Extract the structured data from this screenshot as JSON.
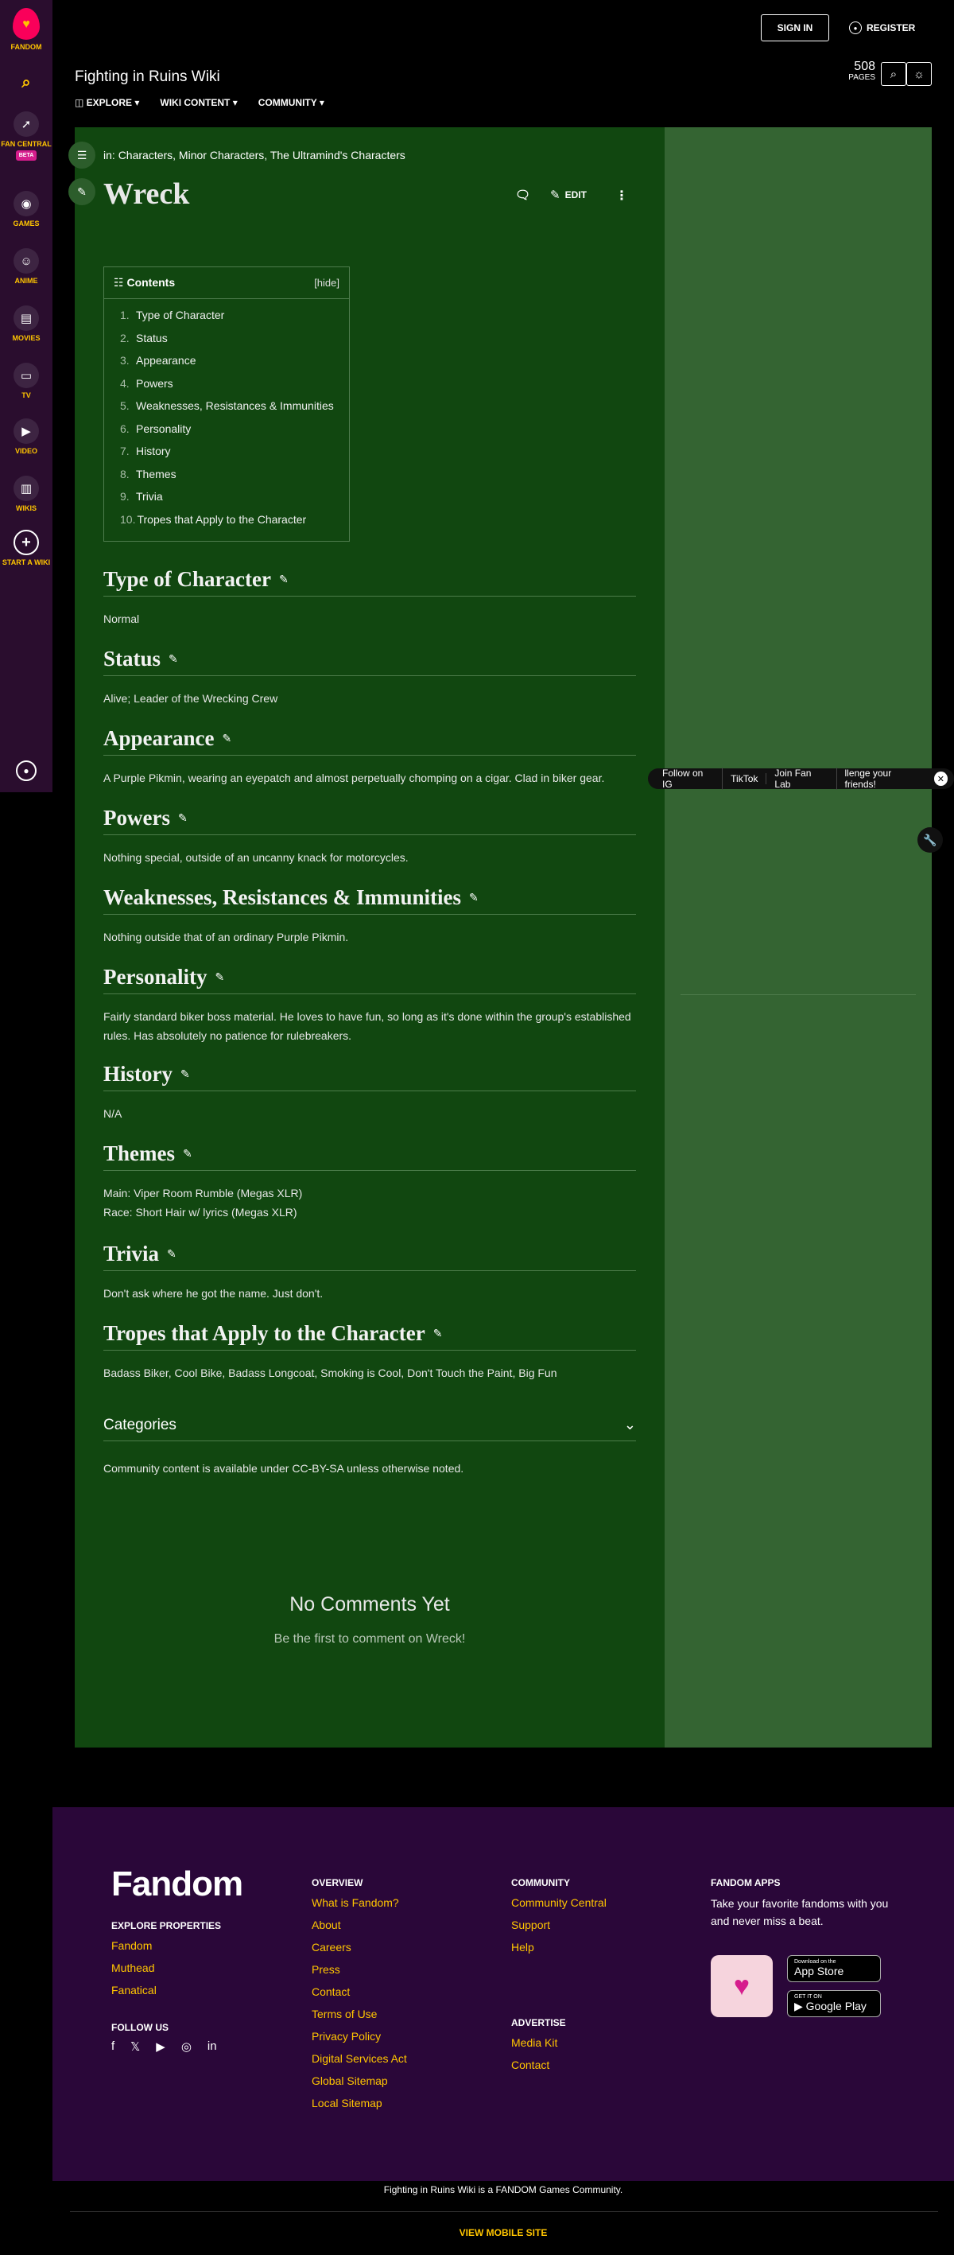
{
  "global_nav": {
    "brand": "FANDOM",
    "items": [
      {
        "label": "",
        "icon": "search-icon"
      },
      {
        "label": "FAN CENTRAL",
        "icon": "rocket-icon",
        "badge": "BETA"
      },
      {
        "label": "GAMES",
        "icon": "gamepad-icon"
      },
      {
        "label": "ANIME",
        "icon": "anime-icon"
      },
      {
        "label": "MOVIES",
        "icon": "clapperboard-icon"
      },
      {
        "label": "TV",
        "icon": "tv-icon"
      },
      {
        "label": "VIDEO",
        "icon": "play-icon"
      },
      {
        "label": "WIKIS",
        "icon": "book-icon"
      },
      {
        "label": "START A WIKI",
        "icon": "plus-icon"
      }
    ],
    "account_icon": "user-icon"
  },
  "topbar": {
    "sign_in": "SIGN IN",
    "register": "REGISTER"
  },
  "wiki": {
    "name": "Fighting in Ruins Wiki",
    "menu": [
      "EXPLORE",
      "WIKI CONTENT",
      "COMMUNITY"
    ],
    "pages_count": "508",
    "pages_label": "PAGES"
  },
  "article": {
    "breadcrumb_prefix": "in: ",
    "categories_inline": "Characters, Minor Characters, The Ultramind's Characters",
    "title": "Wreck",
    "edit_label": "EDIT",
    "toc": {
      "title": "Contents",
      "hide": "[hide]",
      "items": [
        {
          "n": "1.",
          "label": "Type of Character"
        },
        {
          "n": "2.",
          "label": "Status"
        },
        {
          "n": "3.",
          "label": "Appearance"
        },
        {
          "n": "4.",
          "label": "Powers"
        },
        {
          "n": "5.",
          "label": "Weaknesses, Resistances & Immunities"
        },
        {
          "n": "6.",
          "label": "Personality"
        },
        {
          "n": "7.",
          "label": "History"
        },
        {
          "n": "8.",
          "label": "Themes"
        },
        {
          "n": "9.",
          "label": "Trivia"
        },
        {
          "n": "10.",
          "label": "Tropes that Apply to the Character"
        }
      ]
    },
    "sections": [
      {
        "title": "Type of Character",
        "body": "Normal"
      },
      {
        "title": "Status",
        "body": "Alive; Leader of the Wrecking Crew"
      },
      {
        "title": "Appearance",
        "body": "A Purple Pikmin, wearing an eyepatch and almost perpetually chomping on a cigar. Clad in biker gear."
      },
      {
        "title": "Powers",
        "body": "Nothing special, outside of an uncanny knack for motorcycles."
      },
      {
        "title": "Weaknesses, Resistances & Immunities",
        "body": "Nothing outside that of an ordinary Purple Pikmin."
      },
      {
        "title": "Personality",
        "body": "Fairly standard biker boss material. He loves to have fun, so long as it's done within the group's established rules. Has absolutely no patience for rulebreakers."
      },
      {
        "title": "History",
        "body": "N/A"
      },
      {
        "title": "Themes",
        "body": "Main: Viper Room Rumble (Megas XLR)",
        "body2": "Race: Short Hair w/ lyrics (Megas XLR)"
      },
      {
        "title": "Trivia",
        "body": "Don't ask where he got the name. Just don't."
      },
      {
        "title": "Tropes that Apply to the Character",
        "body": "Badass Biker, Cool Bike, Badass Longcoat, Smoking is Cool, Don't Touch the Paint, Big Fun"
      }
    ],
    "categories_label": "Categories",
    "license": "Community content is available under CC-BY-SA unless otherwise noted."
  },
  "comments": {
    "title": "No Comments Yet",
    "subtitle": "Be the first to comment on Wreck!"
  },
  "notification_bar": {
    "items": [
      "Follow on IG",
      "TikTok",
      "Join Fan Lab",
      "llenge your friends!"
    ]
  },
  "footer": {
    "logo": "Fandom",
    "explore_heading": "EXPLORE PROPERTIES",
    "explore_links": [
      "Fandom",
      "Muthead",
      "Fanatical"
    ],
    "follow_heading": "FOLLOW US",
    "overview_heading": "OVERVIEW",
    "overview_links": [
      "What is Fandom?",
      "About",
      "Careers",
      "Press",
      "Contact",
      "Terms of Use",
      "Privacy Policy",
      "Digital Services Act",
      "Global Sitemap",
      "Local Sitemap"
    ],
    "community_heading": "COMMUNITY",
    "community_links": [
      "Community Central",
      "Support",
      "Help"
    ],
    "advertise_heading": "ADVERTISE",
    "advertise_links": [
      "Media Kit",
      "Contact"
    ],
    "apps_heading": "FANDOM APPS",
    "apps_text": "Take your favorite fandoms with you and never miss a beat.",
    "app_store_small": "Download on the",
    "app_store": "App Store",
    "google_play_small": "GET IT ON",
    "google_play": "Google Play",
    "community_note": "Fighting in Ruins Wiki is a FANDOM Games Community.",
    "mobile_site": "VIEW MOBILE SITE"
  },
  "colors": {
    "accent": "#ffc500",
    "article_bg": "#114710",
    "rail_bg": "#346432",
    "footer_bg": "#2a0739",
    "nav_bg": "#2a0d2e"
  }
}
